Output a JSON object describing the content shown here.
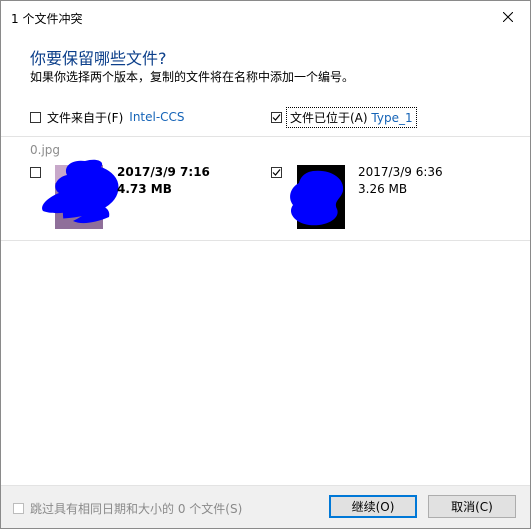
{
  "window": {
    "title": "1 个文件冲突"
  },
  "heading": "你要保留哪些文件?",
  "subheading": "如果你选择两个版本，复制的文件将在名称中添加一个编号。",
  "source": {
    "label": "文件来自于(F)",
    "location": "Intel-CCS",
    "checked": false
  },
  "destination": {
    "label": "文件已位于(A)",
    "location": "Type_1",
    "checked": true
  },
  "files": [
    {
      "name": "0.jpg",
      "source_file": {
        "date": "2017/3/9 7:16",
        "size": "4.73 MB",
        "checked": false
      },
      "dest_file": {
        "date": "2017/3/9 6:36",
        "size": "3.26 MB",
        "checked": true
      }
    }
  ],
  "footer": {
    "skip_label": "跳过具有相同日期和大小的 0 个文件(S)",
    "continue_label": "继续(O)",
    "cancel_label": "取消(C)"
  },
  "colors": {
    "heading": "#0c3f8a",
    "link": "#1463b7",
    "primary_border": "#0078d7",
    "redaction": "#0000ff"
  },
  "icons": {
    "close": "close-icon",
    "checkmark": "checkmark-icon"
  }
}
